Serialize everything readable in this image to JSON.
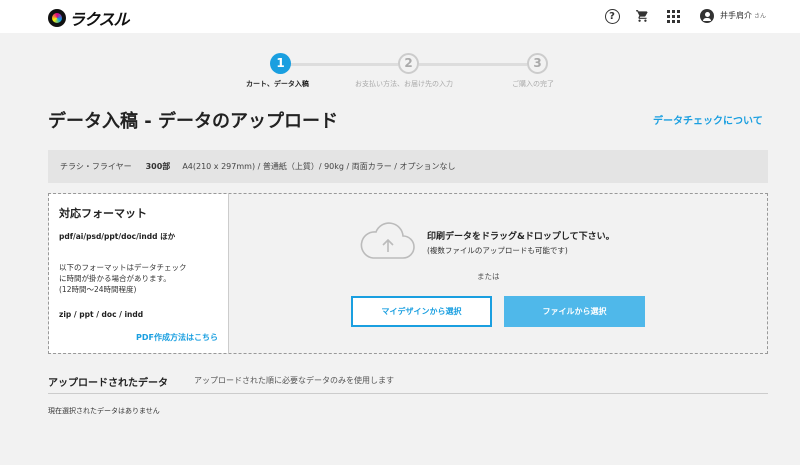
{
  "header": {
    "logo_text": "ラクスル",
    "user_name": "井手肩介",
    "user_suffix": "さん",
    "icons": [
      "help-icon",
      "cart-icon",
      "apps-icon",
      "account-icon"
    ]
  },
  "steps": [
    {
      "number": "1",
      "label": "カート、データ入稿",
      "active": true
    },
    {
      "number": "2",
      "label": "お支払い方法、お届け先の入力",
      "active": false
    },
    {
      "number": "3",
      "label": "ご購入の完了",
      "active": false
    }
  ],
  "page": {
    "title": "データ入稿 - データのアップロード",
    "check_link": "データチェックについて"
  },
  "spec": {
    "product": "チラシ・フライヤー",
    "quantity": "300部",
    "detail": "A4(210 x 297mm) / 普通紙（上質）/ 90kg / 両面カラー / オプションなし"
  },
  "formats": {
    "title": "対応フォーマット",
    "list": "pdf/ai/psd/ppt/doc/indd ほか",
    "note_line1": "以下のフォーマットはデータチェック",
    "note_line2": "に時間が掛かる場合があります。",
    "note_line3": "(12時間〜24時間程度)",
    "slow_list": "zip / ppt / doc / indd",
    "pdf_link": "PDF作成方法はこちら"
  },
  "dropzone": {
    "title": "印刷データをドラッグ&ドロップして下さい。",
    "subtitle": "(複数ファイルのアップロードも可能です)",
    "or": "または",
    "mydesign_button": "マイデザインから選択",
    "file_button": "ファイルから選択"
  },
  "uploaded": {
    "title": "アップロードされたデータ",
    "description": "アップロードされた順に必要なデータのみを使用します",
    "empty": "現在選択されたデータはありません"
  },
  "colors": {
    "accent": "#1a9fe0",
    "button_fill": "#4fb8ea"
  }
}
